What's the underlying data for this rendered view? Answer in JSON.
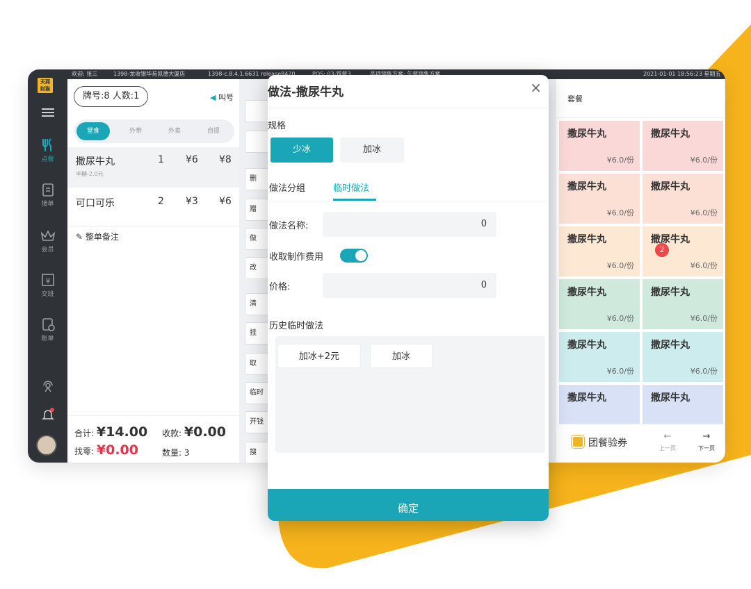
{
  "colors": {
    "accent": "#1aa6b7",
    "brand_yellow": "#f0b429",
    "price_red": "#e8334a",
    "sidebar": "#2f3338"
  },
  "sidebar": {
    "logo": [
      "天燕",
      "财猫"
    ],
    "items": [
      {
        "label": "点餐",
        "icon": "fork-knife-icon",
        "active": true
      },
      {
        "label": "接单",
        "icon": "clipboard-icon"
      },
      {
        "label": "会员",
        "icon": "crown-icon"
      },
      {
        "label": "交班",
        "icon": "yen-box-icon"
      },
      {
        "label": "账单",
        "icon": "bill-icon"
      }
    ]
  },
  "topbar": {
    "welcome": "欢迎: 张三",
    "store": "1398-龙收银华苑凯德大厦店",
    "version": "1398-c.8.4.1.6631 release8420",
    "pos": "POS: 03-铁餐3",
    "plan": "品项销售方案: 午餐销售方案",
    "datetime": "2021-01-01 18:56:23 星期五"
  },
  "order": {
    "table_info": "牌号:8  人数:1",
    "call_label": "叫号",
    "modes": [
      "堂食",
      "外带",
      "外卖",
      "自提"
    ],
    "items": [
      {
        "name": "撒尿牛丸",
        "qty": "1",
        "price": "¥6",
        "total": "¥8",
        "note": "半糖-2.0元"
      },
      {
        "name": "可口可乐",
        "qty": "2",
        "price": "¥3",
        "total": "¥6",
        "note": ""
      }
    ],
    "remark": "整单备注",
    "total_label": "合计:",
    "total": "¥14.00",
    "received_label": "收款:",
    "received": "¥0.00",
    "change_label": "找零:",
    "change": "¥0.00",
    "count_label": "数量:",
    "count": "3"
  },
  "actions": [
    "",
    "",
    "删",
    "赠",
    "做",
    "改",
    "清",
    "挂",
    "取",
    "临时",
    "开钱",
    "搜"
  ],
  "grid": {
    "tab": "套餐",
    "tiles": [
      {
        "name": "撒尿牛丸",
        "price": "¥6.0/份",
        "bg": "#fbd8d8"
      },
      {
        "name": "撒尿牛丸",
        "price": "¥6.0/份",
        "bg": "#fbd8d8"
      },
      {
        "name": "撒尿牛丸",
        "price": "¥6.0/份",
        "bg": "#fce0d6"
      },
      {
        "name": "撒尿牛丸",
        "price": "¥6.0/份",
        "bg": "#fce0d6"
      },
      {
        "name": "撒尿牛丸",
        "price": "¥6.0/份",
        "bg": "#fde8d4"
      },
      {
        "name": "撒尿牛丸",
        "price": "¥6.0/份",
        "bg": "#fde8d4"
      },
      {
        "name": "撒尿牛丸",
        "price": "¥6.0/份",
        "bg": "#cfe9dd"
      },
      {
        "name": "撒尿牛丸",
        "price": "¥6.0/份",
        "bg": "#cfe9dd"
      },
      {
        "name": "撒尿牛丸",
        "price": "¥6.0/份",
        "bg": "#cdeced"
      },
      {
        "name": "撒尿牛丸",
        "price": "¥6.0/份",
        "bg": "#cdeced"
      },
      {
        "name": "撒尿牛丸",
        "price": "",
        "bg": "#d9e1f7"
      },
      {
        "name": "撒尿牛丸",
        "price": "",
        "bg": "#d9e1f7"
      }
    ],
    "badge": "2",
    "voucher": "团餐验券",
    "prev_label": "上一页",
    "next_label": "下一页"
  },
  "modal": {
    "title": "做法-撒尿牛丸",
    "close": "×",
    "spec_label": "规格",
    "specs": [
      "少冰",
      "加冰"
    ],
    "tabs": [
      "做法分组",
      "临时做法"
    ],
    "name_label": "做法名称:",
    "name_value": "0",
    "fee_label": "收取制作费用",
    "price_label": "价格:",
    "price_value": "0",
    "history_label": "历史临时做法",
    "history": [
      "加冰+2元",
      "加冰"
    ],
    "confirm": "确定"
  }
}
